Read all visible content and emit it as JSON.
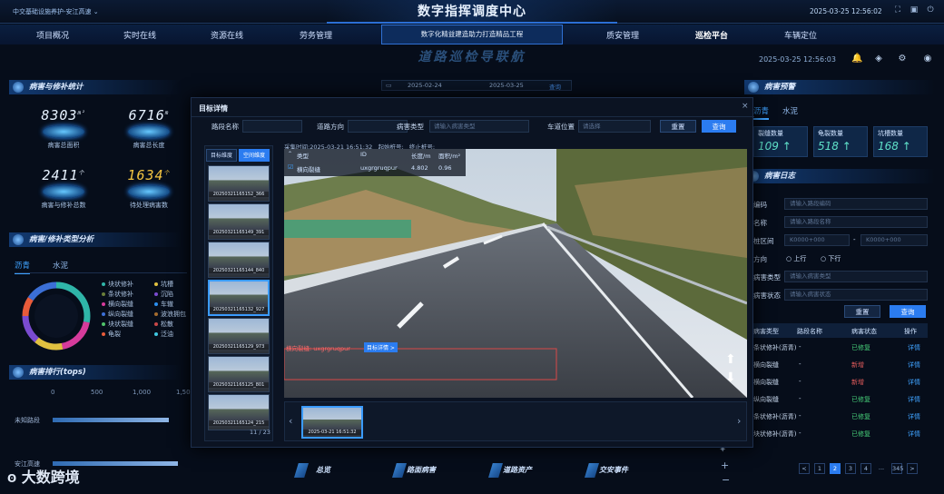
{
  "header": {
    "org": "中交基础设施养护-安江高速",
    "org_chevron": "chevron-down-icon",
    "title": "数字指挥调度中心",
    "datetime": "2025-03-25 12:56:02"
  },
  "nav": {
    "items": [
      "项目概况",
      "实时在线",
      "资源在线",
      "劳务管理",
      "质安管理",
      "巡检平台",
      "车辆定位"
    ],
    "active": "巡检平台",
    "center": "数字化精益建造助力打造精品工程"
  },
  "subtitle": "道路巡检导联航",
  "subheader": {
    "time": "2025-03-25 12:56:03"
  },
  "date_filter": {
    "start": "2025-02-24",
    "end": "2025-03-25",
    "query": "查询"
  },
  "left": {
    "stats_title": "病害与修补统计",
    "stats": [
      {
        "value": "8303",
        "unit": "m²",
        "label": "病害总面积"
      },
      {
        "value": "6716",
        "unit": "m",
        "label": "病害总长度"
      },
      {
        "value": "2411",
        "unit": "个",
        "label": "病害与修补总数"
      },
      {
        "value": "1634",
        "unit": "个",
        "label": "待处理病害数"
      }
    ],
    "type_title": "病害/修补类型分析",
    "tabs": [
      "沥青",
      "水泥"
    ],
    "legend": [
      {
        "name": "块状修补",
        "color": "#2fb5a8"
      },
      {
        "name": "条状修补",
        "color": "#6a7f3a"
      },
      {
        "name": "横向裂缝",
        "color": "#d63b9b"
      },
      {
        "name": "纵向裂缝",
        "color": "#3b6fd6"
      },
      {
        "name": "块状裂缝",
        "color": "#4fc46a"
      },
      {
        "name": "龟裂",
        "color": "#e85b3a"
      },
      {
        "name": "坑槽",
        "color": "#e0c040"
      },
      {
        "name": "沉陷",
        "color": "#7a4bd0"
      },
      {
        "name": "车辙",
        "color": "#2b8ff0"
      },
      {
        "name": "波浪拥包",
        "color": "#a36b2e"
      },
      {
        "name": "松散",
        "color": "#c94848"
      },
      {
        "name": "泛油",
        "color": "#3fc7e0"
      }
    ],
    "rank_title": "病害排行(tops)",
    "rank_axis": [
      "0",
      "500",
      "1,000",
      "1,50"
    ],
    "rank_rows": [
      {
        "label": "未知路段",
        "value": 1420
      },
      {
        "label": "安江高速",
        "value": 1530
      }
    ]
  },
  "modal": {
    "title": "目标详情",
    "fields": [
      {
        "label": "路段名称",
        "placeholder": ""
      },
      {
        "label": "道路方向",
        "placeholder": ""
      },
      {
        "label": "病害类型",
        "placeholder": "请输入病害类型"
      },
      {
        "label": "车道位置",
        "placeholder": "请选择"
      }
    ],
    "reset": "重置",
    "query": "查询",
    "view_tabs": [
      "目标维度",
      "空间维度"
    ],
    "capture_label": "采集时间:",
    "capture_time": "2025-03-21 16:51:32",
    "start_label": "起始桩号:",
    "end_label": "终止桩号:",
    "thumbs": [
      "20250321165152_366",
      "20250321165149_391",
      "20250321165144_840",
      "20250321165132_927",
      "20250321165129_973",
      "20250321165125_801",
      "20250321165124_215"
    ],
    "thumb_count": "11 / 23",
    "table_headers": [
      "类型",
      "ID",
      "长度/m",
      "面积/m²"
    ],
    "table_row": [
      "横向裂缝",
      "uxgrgruqpur",
      "4.802",
      "0.96"
    ],
    "annotation": "横向裂缝: uxgrgruqpur",
    "annotation_link": "目标详情 >",
    "strip_caption": "2025-03-21 16:51:32"
  },
  "right": {
    "warning_title": "病害预警",
    "tabs": [
      "沥青",
      "水泥"
    ],
    "cards": [
      {
        "label": "裂缝数量",
        "value": "109"
      },
      {
        "label": "龟裂数量",
        "value": "518"
      },
      {
        "label": "坑槽数量",
        "value": "168"
      }
    ],
    "log_title": "病害日志",
    "form": [
      {
        "label": "编码",
        "placeholder": "请输入路段编码"
      },
      {
        "label": "名称",
        "placeholder": "请输入路段名称"
      },
      {
        "label": "桩区间",
        "placeholder": "K0000+000",
        "placeholder2": "K0000+000"
      },
      {
        "label": "方向",
        "opt1": "上行",
        "opt2": "下行"
      },
      {
        "label": "病害类型",
        "placeholder": "请输入病害类型"
      },
      {
        "label": "病害状态",
        "placeholder": "请输入病害状态"
      }
    ],
    "reset": "重置",
    "query": "查询",
    "headers": [
      "病害类型",
      "路段名称",
      "病害状态",
      "操作"
    ],
    "rows": [
      {
        "type": "条状修补(沥青)",
        "road": "-",
        "status": "已修复",
        "op": "详情"
      },
      {
        "type": "横向裂缝",
        "road": "-",
        "status": "新增",
        "op": "详情"
      },
      {
        "type": "横向裂缝",
        "road": "-",
        "status": "新增",
        "op": "详情"
      },
      {
        "type": "纵向裂缝",
        "road": "-",
        "status": "已修复",
        "op": "详情"
      },
      {
        "type": "条状修补(沥青)",
        "road": "-",
        "status": "已修复",
        "op": "详情"
      },
      {
        "type": "块状修补(沥青)",
        "road": "-",
        "status": "已修复",
        "op": "详情"
      }
    ],
    "pages": [
      "<",
      "1",
      "2",
      "3",
      "4",
      "...",
      "345",
      ">"
    ]
  },
  "dock": [
    "总览",
    "路面病害",
    "道路资产",
    "交安事件"
  ],
  "watermark": "大数跨境"
}
